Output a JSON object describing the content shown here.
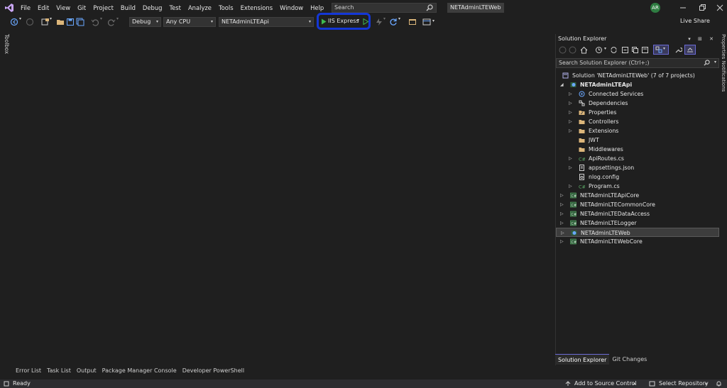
{
  "menu": {
    "items": [
      "File",
      "Edit",
      "View",
      "Git",
      "Project",
      "Build",
      "Debug",
      "Test",
      "Analyze",
      "Tools",
      "Extensions",
      "Window",
      "Help"
    ]
  },
  "search": {
    "placeholder": "Search"
  },
  "solution_badge": "NETAdminLTEWeb",
  "user_initials": "AR",
  "toolbar": {
    "configuration": "Debug",
    "platform": "Any CPU",
    "startup_project": "NETAdminLTEApi",
    "run_target": "IIS Express",
    "live_share": "Live Share"
  },
  "left_tab": "Toolbox",
  "right_tabs": "Properties   Notifications",
  "solution_explorer": {
    "title": "Solution Explorer",
    "search_placeholder": "Search Solution Explorer (Ctrl+;)",
    "tree": [
      {
        "label": "Solution 'NETAdminLTEWeb' (7 of 7 projects)",
        "icon": "solution-icon",
        "level": 0,
        "expander": ""
      },
      {
        "label": "NETAdminLTEApi",
        "icon": "web-project-icon",
        "level": 1,
        "expander": "expanded",
        "bold": true
      },
      {
        "label": "Connected Services",
        "icon": "connected-services-icon",
        "level": 2,
        "expander": "collapsed"
      },
      {
        "label": "Dependencies",
        "icon": "dependencies-icon",
        "level": 2,
        "expander": "collapsed"
      },
      {
        "label": "Properties",
        "icon": "wrench-folder-icon",
        "level": 2,
        "expander": "collapsed"
      },
      {
        "label": "Controllers",
        "icon": "folder-icon",
        "level": 2,
        "expander": "collapsed"
      },
      {
        "label": "Extensions",
        "icon": "folder-icon",
        "level": 2,
        "expander": "collapsed"
      },
      {
        "label": "JWT",
        "icon": "folder-icon",
        "level": 2,
        "expander": ""
      },
      {
        "label": "Middlewares",
        "icon": "folder-icon",
        "level": 2,
        "expander": ""
      },
      {
        "label": "ApiRoutes.cs",
        "icon": "csharp-file-icon",
        "level": 2,
        "expander": "collapsed"
      },
      {
        "label": "appsettings.json",
        "icon": "json-file-icon",
        "level": 2,
        "expander": "collapsed"
      },
      {
        "label": "nlog.config",
        "icon": "config-file-icon",
        "level": 2,
        "expander": ""
      },
      {
        "label": "Program.cs",
        "icon": "csharp-file-icon",
        "level": 2,
        "expander": "collapsed"
      },
      {
        "label": "NETAdminLTEApiCore",
        "icon": "csharp-project-icon",
        "level": 1,
        "expander": "collapsed"
      },
      {
        "label": "NETAdminLTECommonCore",
        "icon": "csharp-project-icon",
        "level": 1,
        "expander": "collapsed"
      },
      {
        "label": "NETAdminLTEDataAccess",
        "icon": "csharp-project-icon",
        "level": 1,
        "expander": "collapsed"
      },
      {
        "label": "NETAdminLTELogger",
        "icon": "csharp-project-icon",
        "level": 1,
        "expander": "collapsed"
      },
      {
        "label": "NETAdminLTEWeb",
        "icon": "web-project-icon",
        "level": 1,
        "expander": "collapsed",
        "selected": true
      },
      {
        "label": "NETAdminLTEWebCore",
        "icon": "csharp-project-icon",
        "level": 1,
        "expander": "collapsed"
      }
    ],
    "tabs": [
      "Solution Explorer",
      "Git Changes"
    ]
  },
  "bottom_tabs": [
    "Error List",
    "Task List",
    "Output",
    "Package Manager Console",
    "Developer PowerShell"
  ],
  "status": {
    "ready": "Ready",
    "add_to_source": "Add to Source Control",
    "select_repository": "Select Repository"
  },
  "colors": {
    "background": "#1f1f1f",
    "accent_highlight": "#1437d6",
    "run_green": "#3fb950",
    "avatar": "#2f7d42",
    "folder": "#dcb67a"
  }
}
